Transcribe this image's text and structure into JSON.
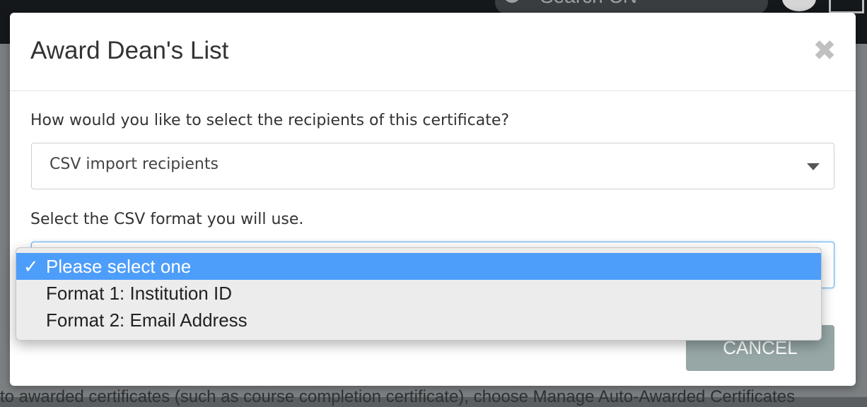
{
  "background": {
    "search_text": "Search CN",
    "bottom_text": "to awarded certificates (such as course completion certificate), choose Manage Auto-Awarded Certificates"
  },
  "modal": {
    "title": "Award Dean's List",
    "close_glyph": "✖",
    "recipients_label": "How would you like to select the recipients of this certificate?",
    "recipients_value": "CSV import recipients",
    "csv_format_label": "Select the CSV format you will use.",
    "cancel_label": "CANCEL"
  },
  "dropdown": {
    "options": [
      {
        "label": "Please select one",
        "selected": true
      },
      {
        "label": "Format 1: Institution ID",
        "selected": false
      },
      {
        "label": "Format 2: Email Address",
        "selected": false
      }
    ],
    "check_glyph": "✓"
  },
  "colors": {
    "selected_option": "#4d9dfb",
    "cancel_button": "#96a7a6",
    "focus_border": "#66afe9"
  }
}
